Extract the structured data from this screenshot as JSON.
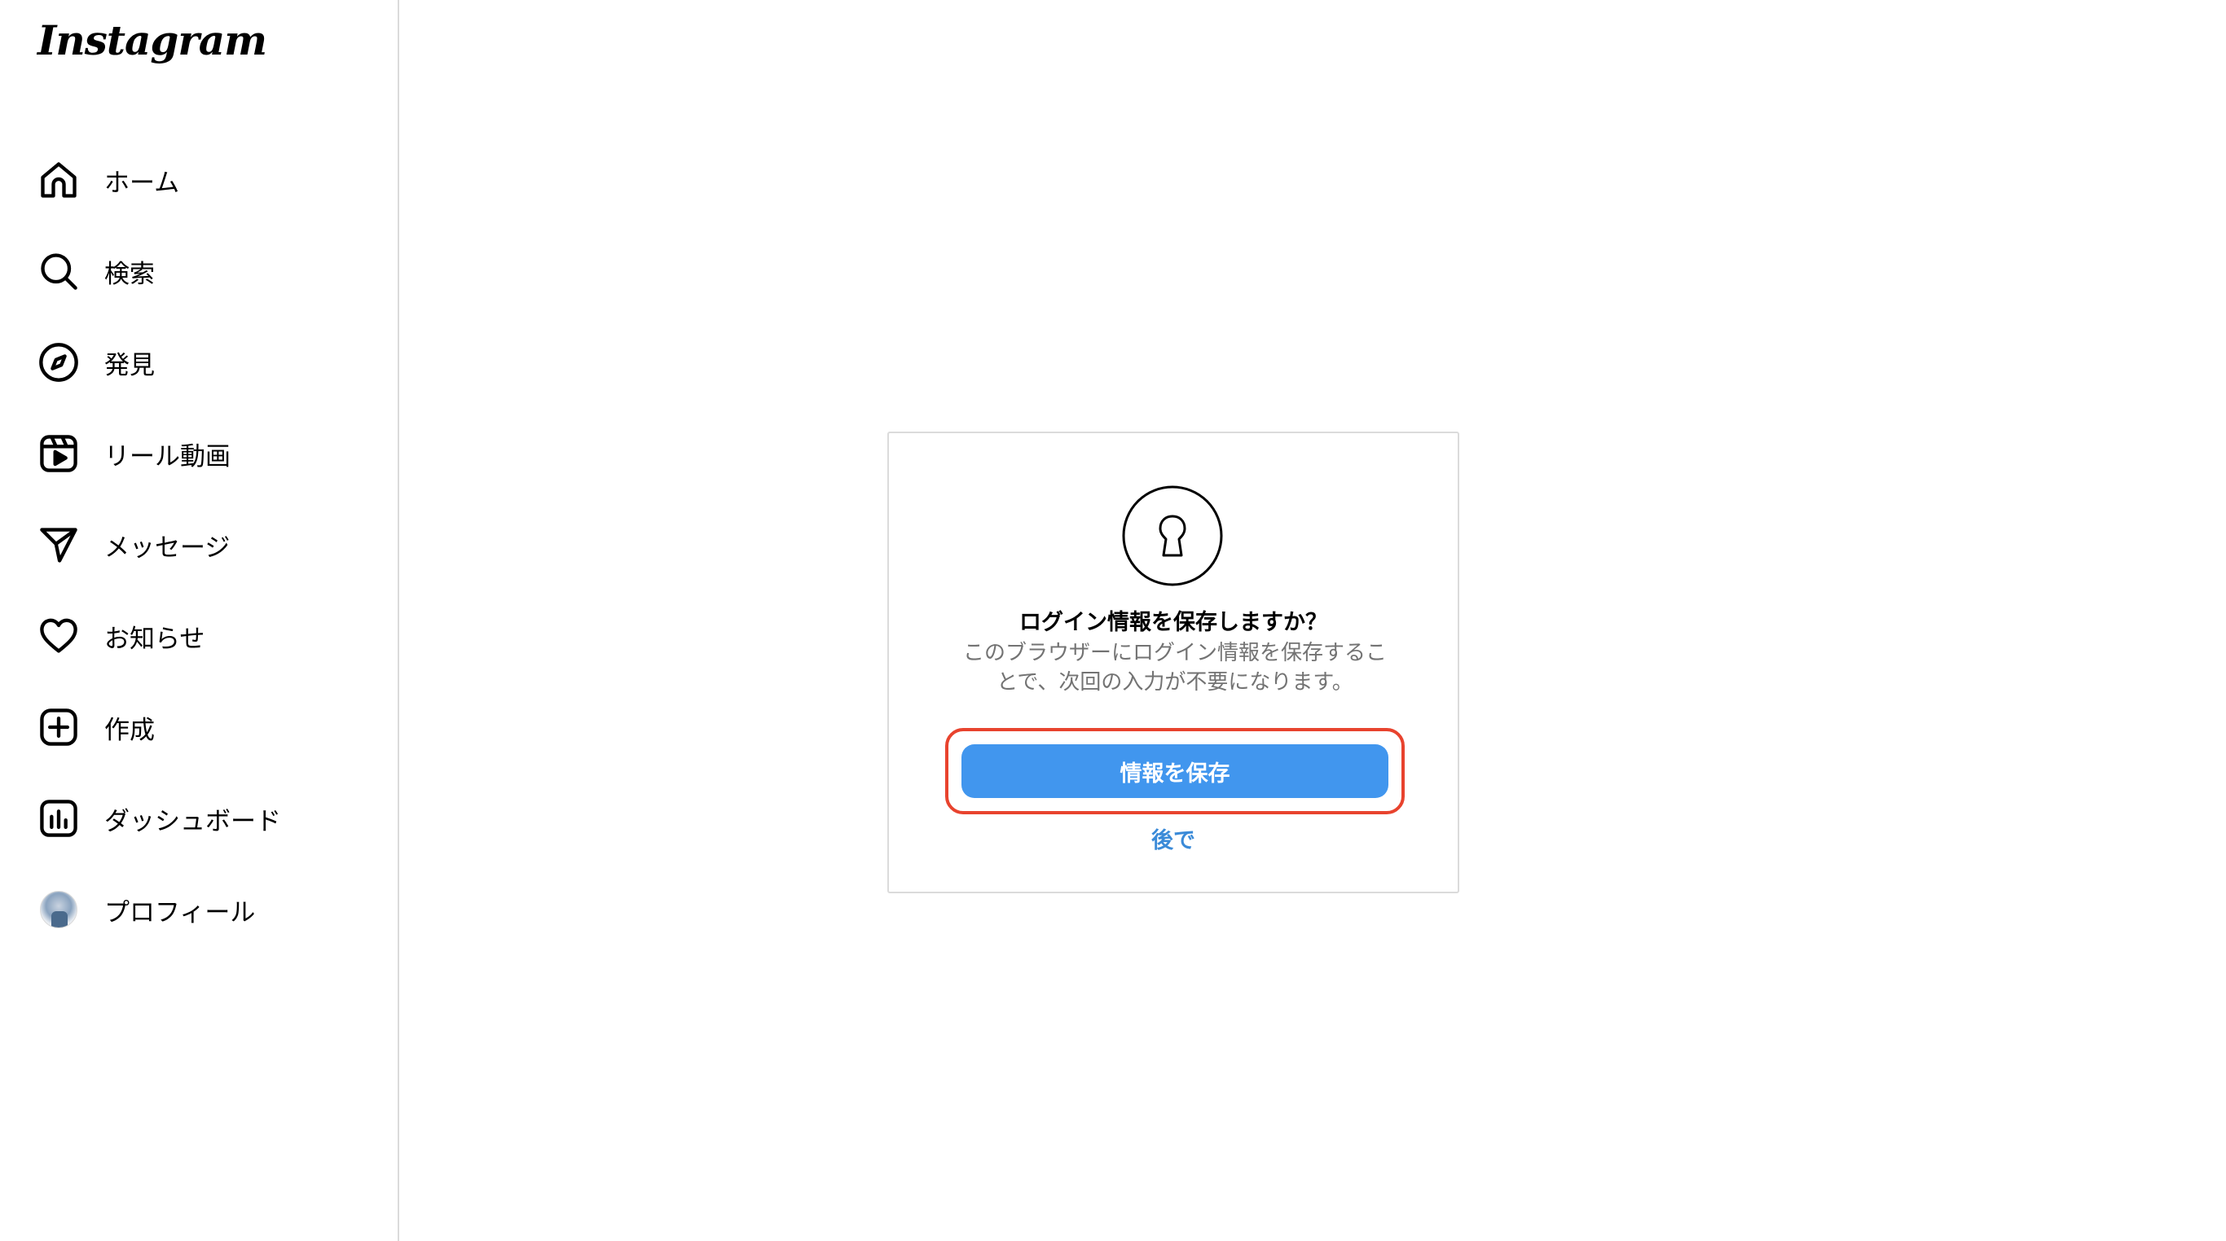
{
  "app": {
    "logo_text": "Instagram"
  },
  "sidebar": {
    "items": [
      {
        "label": "ホーム",
        "icon": "home-icon"
      },
      {
        "label": "検索",
        "icon": "search-icon"
      },
      {
        "label": "発見",
        "icon": "compass-icon"
      },
      {
        "label": "リール動画",
        "icon": "reels-icon"
      },
      {
        "label": "メッセージ",
        "icon": "paper-plane-icon"
      },
      {
        "label": "お知らせ",
        "icon": "heart-icon"
      },
      {
        "label": "作成",
        "icon": "plus-square-icon"
      },
      {
        "label": "ダッシュボード",
        "icon": "dashboard-icon"
      },
      {
        "label": "プロフィール",
        "icon": "avatar"
      }
    ]
  },
  "dialog": {
    "icon": "keyhole-lock-icon",
    "title": "ログイン情報を保存しますか？",
    "description": "このブラウザーにログイン情報を保存することで、次回の入力が不要になります。",
    "save_label": "情報を保存",
    "later_label": "後で"
  },
  "colors": {
    "primary_button": "#4196ee",
    "link": "#3a8ad8",
    "highlight_ring": "#e8432e",
    "secondary_text": "#737373",
    "border": "#dbdbdb"
  }
}
